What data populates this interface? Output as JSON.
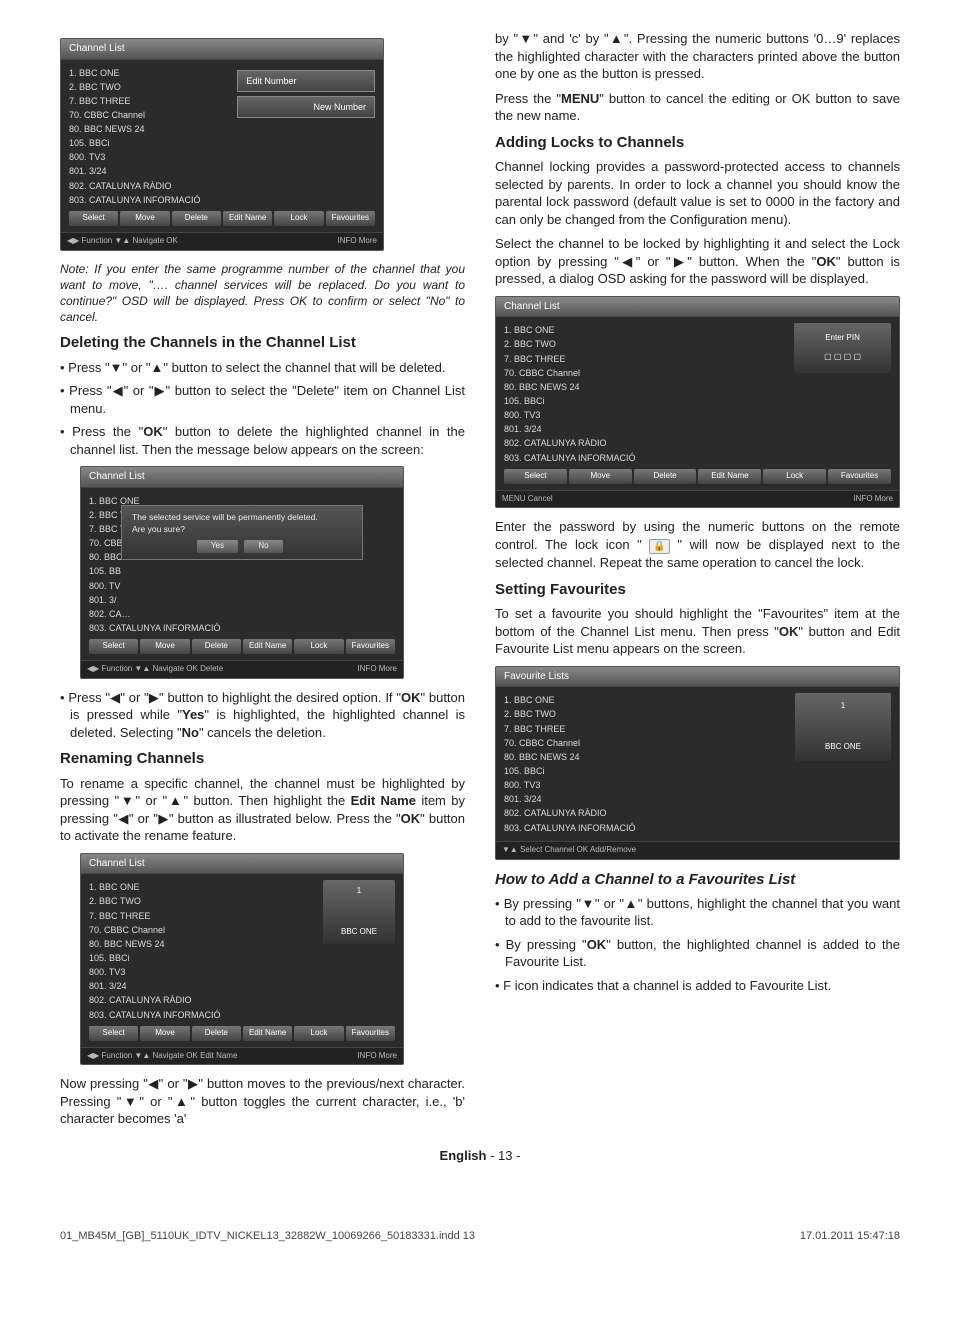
{
  "channels": [
    "1. BBC ONE",
    "2. BBC TWO",
    "7. BBC THREE",
    "70. CBBC Channel",
    "80. BBC NEWS 24",
    "105. BBCi",
    "800. TV3",
    "801. 3/24",
    "802. CATALUNYA RÀDIO",
    "803. CATALUNYA INFORMACIÓ"
  ],
  "scr_actions": [
    "Select",
    "Move",
    "Delete",
    "Edit Name",
    "Lock",
    "Favourites"
  ],
  "scr1": {
    "title": "Channel List",
    "popup": "Edit Number",
    "popup2": "New Number",
    "footer_l": "◀▶ Function ▼▲ Navigate OK",
    "footer_r": "INFO More"
  },
  "scr2": {
    "title": "Channel List",
    "dlg": "The selected service will be permanently deleted.\nAre you sure?",
    "yes": "Yes",
    "no": "No",
    "footer_l": "◀▶ Function ▼▲ Navigate OK Delete",
    "footer_r": "INFO More"
  },
  "scr3": {
    "title": "Channel List",
    "side_num": "1",
    "side_name": "BBC ONE",
    "footer_l": "◀▶ Function ▼▲ Navigate OK Edit Name",
    "footer_r": "INFO More"
  },
  "scr4": {
    "title": "Channel List",
    "enter_pin": "Enter PIN",
    "footer_l": "MENU Cancel",
    "footer_r": "INFO More"
  },
  "scr5": {
    "title": "Favourite Lists",
    "side_num": "1",
    "side_name": "BBC ONE",
    "footer_l": "▼▲ Select Channel  OK Add/Remove",
    "footer_r": ""
  },
  "t": {
    "note1": "Note: If you enter the same programme number of the channel that you want to move, \"…. channel services will be replaced. Do you want to continue?\" OSD will be displayed. Press OK to confirm or select \"No\" to cancel.",
    "h_del": "Deleting the Channels in the Channel List",
    "del1": "Press \"▼\" or \"▲\" button to select the channel that will be deleted.",
    "del2": "Press \"◀\" or \"▶\" button to select the \"Delete\" item on Channel List menu.",
    "del3_a": "Press the \"",
    "del3_b": "\" button to delete the highlighted channel in the channel list. Then the message below appears on the screen:",
    "del4_a": "Press \"◀\" or \"▶\" button to highlight the desired option. If \"",
    "del4_b": "\" button is pressed while \"",
    "del4_c": "\" is highlighted, the highlighted channel is deleted. Selecting \"",
    "del4_d": "\" cancels the deletion.",
    "h_ren": "Renaming Channels",
    "ren1_a": "To rename a specific channel, the channel must be highlighted by pressing \"▼\" or \"▲\" button. Then highlight the ",
    "ren1_b": " item by pressing  \"◀\" or \"▶\" button as illustrated below. Press the \"",
    "ren1_c": "\" button to activate the rename feature.",
    "ren2": "Now pressing \"◀\" or \"▶\" button moves to the previous/next character. Pressing \"▼\" or \"▲\" button toggles the current character, i.e., 'b' character becomes 'a'",
    "rc1": "by \"▼\" and 'c' by \"▲\". Pressing the numeric buttons '0…9' replaces the highlighted character with the characters printed above the button one by one as the button is pressed.",
    "rc2_a": "Press the \"",
    "rc2_b": "\" button to cancel the editing or OK button to save the new name.",
    "h_lock": "Adding Locks to Channels",
    "lock1": "Channel locking provides a password-protected access to channels selected by parents. In order to lock a channel you should know the parental lock password (default value is set to 0000 in the factory and can only be changed from the Configuration menu).",
    "lock2_a": "Select the channel to be locked by highlighting it and select the Lock option by pressing \"◀\" or \"▶\" button. When the \"",
    "lock2_b": "\" button is pressed, a dialog OSD asking for the password will be  displayed.",
    "lock3_a": "Enter the password by using the numeric buttons on the remote control. The lock icon \" ",
    "lock3_b": " \" will now be displayed next to the selected channel. Repeat the same operation to cancel the lock.",
    "h_fav": "Setting Favourites",
    "fav1_a": "To set a favourite you should highlight the \"Favourites\" item at the bottom of the Channel List menu. Then press \"",
    "fav1_b": "\" button and Edit Favourite List menu appears on the screen.",
    "h_addfav": "How to Add a Channel to a Favourites List",
    "add1": "By pressing \"▼\" or \"▲\" buttons, highlight the channel that you want to add to the favourite list.",
    "add2_a": "By pressing \"",
    "add2_b": "\" button, the highlighted channel is added to the Favourite List.",
    "add3": "F icon indicates that a channel is added to Favourite List.",
    "ok": "OK",
    "yes": "Yes",
    "no": "No",
    "menu": "MENU",
    "editname": "Edit Name",
    "pagefoot_a": "English",
    "pagefoot_b": "  - 13 -",
    "meta_l": "01_MB45M_[GB]_5110UK_IDTV_NICKEL13_32882W_10069266_50183331.indd   13",
    "meta_r": "17.01.2011   15:47:18"
  }
}
